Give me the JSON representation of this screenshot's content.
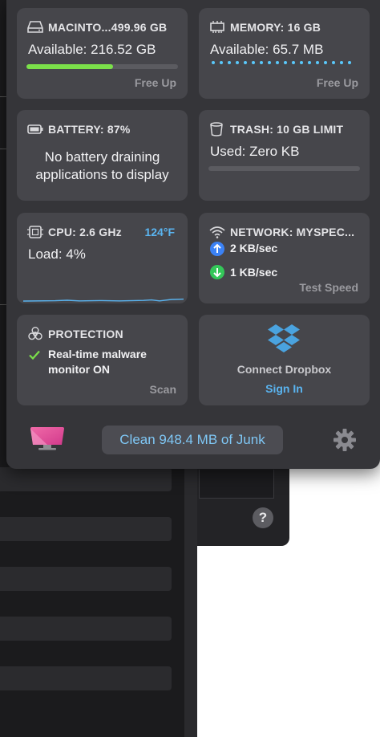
{
  "disk": {
    "title": "MACINTO...499.96 GB",
    "available": "Available: 216.52 GB",
    "used_fraction": 0.57,
    "action": "Free Up"
  },
  "memory": {
    "title": "MEMORY: 16 GB",
    "available": "Available: 65.7 MB",
    "action": "Free Up"
  },
  "battery": {
    "title": "BATTERY: 87%",
    "message": "No battery draining applications to display"
  },
  "trash": {
    "title": "TRASH: 10 GB LIMIT",
    "used": "Used: Zero KB"
  },
  "cpu": {
    "title": "CPU: 2.6 GHz",
    "temperature": "124°F",
    "load": "Load: 4%"
  },
  "network": {
    "title": "NETWORK: MYSPEC...",
    "upload": "2 KB/sec",
    "download": "1 KB/sec",
    "action": "Test Speed"
  },
  "protection": {
    "title": "PROTECTION",
    "status_line1": "Real-time malware",
    "status_line2": "monitor ON",
    "action": "Scan"
  },
  "dropbox": {
    "label": "Connect Dropbox",
    "action": "Sign In"
  },
  "footer": {
    "clean_label": "Clean 948.4 MB of Junk"
  },
  "background": {
    "help_label": "?"
  },
  "icons": {
    "disk": "drive-icon",
    "memory": "memory-chip-icon",
    "battery": "battery-icon",
    "trash": "trash-icon",
    "cpu": "cpu-chip-icon",
    "network": "wifi-icon",
    "protection": "biohazard-icon",
    "dropbox": "dropbox-icon",
    "settings": "gear-icon"
  },
  "colors": {
    "accent_green": "#7be04a",
    "accent_blue": "#5ac8fa",
    "link_blue": "#5ab4f0",
    "upload_blue": "#3b82f6",
    "download_green": "#34c759",
    "logo_pink": "#e8449a"
  }
}
